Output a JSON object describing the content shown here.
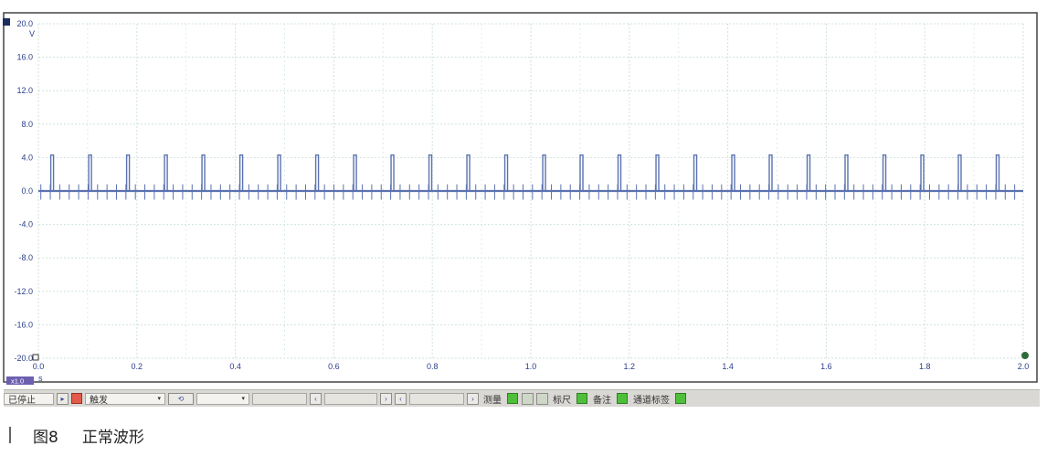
{
  "chart_data": {
    "type": "line",
    "y_unit": "V",
    "x_unit": "s",
    "ylim": [
      -20,
      20
    ],
    "xlim": [
      0,
      2
    ],
    "y_ticks": [
      "20.0",
      "16.0",
      "12.0",
      "8.0",
      "4.0",
      "0.0",
      "-4.0",
      "-8.0",
      "-12.0",
      "-16.0",
      "-20.0"
    ],
    "x_ticks": [
      "0.0",
      "0.2",
      "0.4",
      "0.6",
      "0.8",
      "1.0",
      "1.2",
      "1.4",
      "1.6",
      "1.8",
      "2.0"
    ],
    "grid": true,
    "baseline": 0.0,
    "pulse_amplitude": 4.3,
    "pulse_period": 0.0768,
    "first_pulse": 0.028,
    "pulse_times": [
      0.028,
      0.105,
      0.182,
      0.259,
      0.335,
      0.412,
      0.489,
      0.566,
      0.643,
      0.719,
      0.796,
      0.873,
      0.95,
      1.027,
      1.103,
      1.18,
      1.257,
      1.334,
      1.411,
      1.487,
      1.564,
      1.641,
      1.718,
      1.795,
      1.871,
      1.948
    ],
    "small_tick_period": 0.0192,
    "small_tick_amplitude": 0.8,
    "color": "#5a72b0"
  },
  "scope": {
    "channel_marker": "channel-a-marker",
    "zoom_badge": "x1.0",
    "trigger_dot_color": "#2e6b3a"
  },
  "toolbar": {
    "status": "已停止",
    "trigger_label": "触发",
    "measure_label": "测量",
    "ruler_label": "标尺",
    "notes_label": "备注",
    "channel_tags_label": "通道标签"
  },
  "caption": {
    "figure_number": "图8",
    "title": "正常波形"
  }
}
